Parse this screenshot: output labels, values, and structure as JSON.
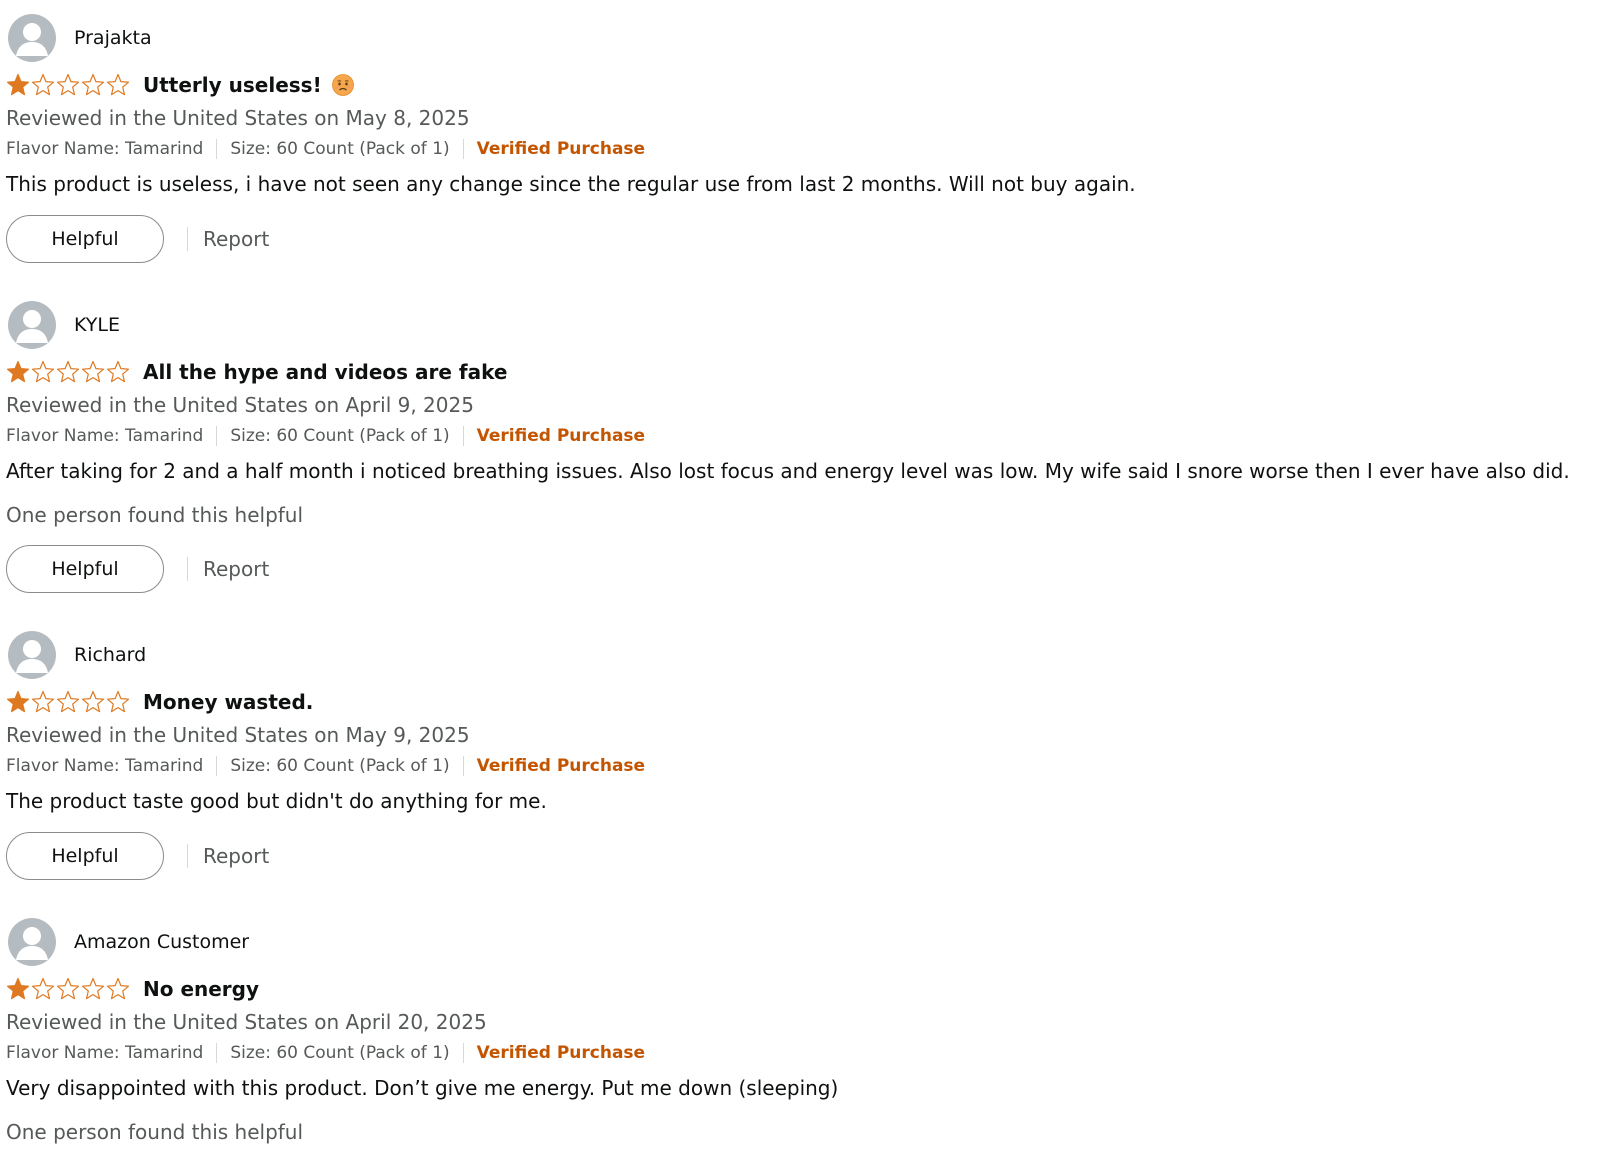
{
  "reviews": [
    {
      "name": "Prajakta",
      "rating": 1,
      "max_rating": 5,
      "title": "Utterly useless!",
      "emoji": "disappointed-face-icon",
      "date": "Reviewed in the United States on May 8, 2025",
      "flavor": "Flavor Name: Tamarind",
      "size": "Size: 60 Count (Pack of 1)",
      "verified": "Verified Purchase",
      "body": "This product is useless, i have not seen any change since the regular use from last 2 months. Will not buy again.",
      "helpful_count": "",
      "helpful_label": "Helpful",
      "report_label": "Report"
    },
    {
      "name": "KYLE",
      "rating": 1,
      "max_rating": 5,
      "title": "All the hype and videos are fake",
      "date": "Reviewed in the United States on April 9, 2025",
      "flavor": "Flavor Name: Tamarind",
      "size": "Size: 60 Count (Pack of 1)",
      "verified": "Verified Purchase",
      "body": "After taking for 2 and a half month i noticed breathing issues. Also lost focus and energy level was low. My wife said I snore worse then I ever have also did.",
      "helpful_count": "One person found this helpful",
      "helpful_label": "Helpful",
      "report_label": "Report"
    },
    {
      "name": "Richard",
      "rating": 1,
      "max_rating": 5,
      "title": "Money wasted.",
      "date": "Reviewed in the United States on May 9, 2025",
      "flavor": "Flavor Name: Tamarind",
      "size": "Size: 60 Count (Pack of 1)",
      "verified": "Verified Purchase",
      "body": "The product taste good but didn't do anything for me.",
      "helpful_count": "",
      "helpful_label": "Helpful",
      "report_label": "Report"
    },
    {
      "name": "Amazon Customer",
      "rating": 1,
      "max_rating": 5,
      "title": "No energy",
      "date": "Reviewed in the United States on April 20, 2025",
      "flavor": "Flavor Name: Tamarind",
      "size": "Size: 60 Count (Pack of 1)",
      "verified": "Verified Purchase",
      "body": "Very disappointed with this product. Don’t give me energy. Put me down (sleeping)",
      "helpful_count": "One person found this helpful"
    }
  ],
  "colors": {
    "star": "#de7921",
    "verified": "#c45500",
    "secondary_text": "#565959",
    "avatar": "#b4bcc1"
  }
}
